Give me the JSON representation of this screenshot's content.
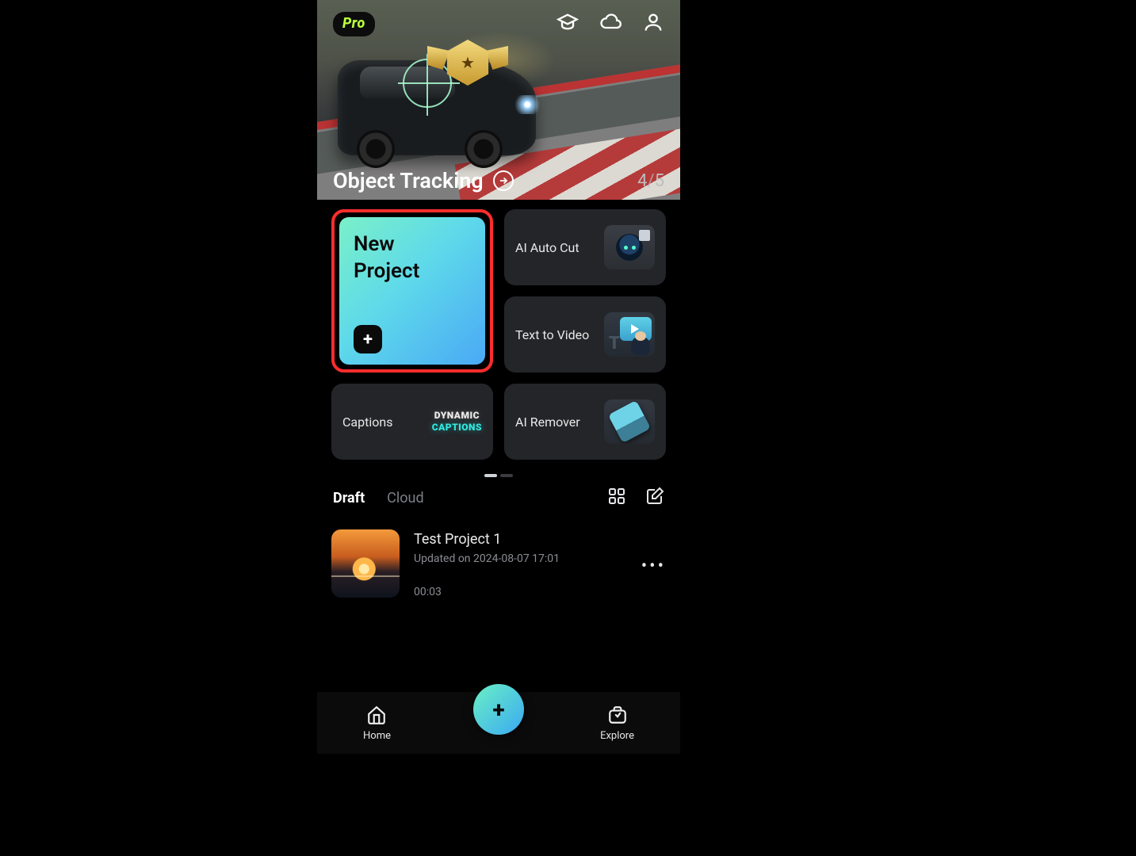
{
  "header": {
    "badge_label": "Pro",
    "hero_title": "Object Tracking",
    "hero_page_current": "4",
    "hero_page_sep": "/",
    "hero_page_total": "5"
  },
  "actions": {
    "new_project_label": "New\nProject",
    "tools": {
      "ai_auto_cut": "AI Auto Cut",
      "text_to_video": "Text to Video",
      "captions": "Captions",
      "captions_tag_line1": "DYNAMIC",
      "captions_tag_line2": "CAPTIONS",
      "ai_remover": "AI Remover"
    }
  },
  "tabs": {
    "draft": "Draft",
    "cloud": "Cloud",
    "active": "draft"
  },
  "projects": [
    {
      "name": "Test Project 1",
      "updated": "Updated on 2024-08-07 17:01",
      "duration": "00:03"
    }
  ],
  "nav": {
    "home": "Home",
    "explore": "Explore"
  },
  "colors": {
    "highlight_red": "#ff2d2d",
    "accent_gradient_start": "#7af0c8",
    "accent_gradient_end": "#4aa9f5",
    "pro_green": "#b9ff3b"
  }
}
